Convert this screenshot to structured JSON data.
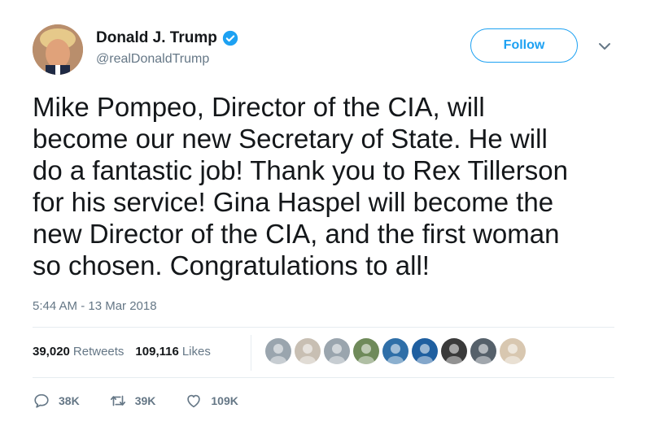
{
  "author": {
    "display_name": "Donald J. Trump",
    "handle": "@realDonaldTrump",
    "verified": true
  },
  "follow_button": {
    "label": "Follow"
  },
  "tweet": {
    "lines": [
      "Mike Pompeo, Director of the CIA, will",
      "become our new Secretary of State. He will",
      "do a fantastic job! Thank you to Rex Tillerson",
      "for his service! Gina Haspel will become the",
      "new Director of the CIA, and the first woman",
      "so chosen. Congratulations to all!"
    ],
    "timestamp": "5:44 AM - 13 Mar 2018"
  },
  "stats": {
    "retweets_count": "39,020",
    "retweets_label": "Retweets",
    "likes_count": "109,116",
    "likes_label": "Likes"
  },
  "liker_avatars": [
    "#9aa5ae",
    "#c8bfb3",
    "#9aa5ae",
    "#6f8a5a",
    "#2f6fa8",
    "#1f5fa0",
    "#3a3a3a",
    "#55606a",
    "#d8c7b0"
  ],
  "actions": {
    "reply_count": "38K",
    "retweet_count": "39K",
    "like_count": "109K"
  },
  "colors": {
    "accent": "#1da1f2",
    "text": "#14171a",
    "muted": "#657786",
    "divider": "#e6ecf0"
  }
}
